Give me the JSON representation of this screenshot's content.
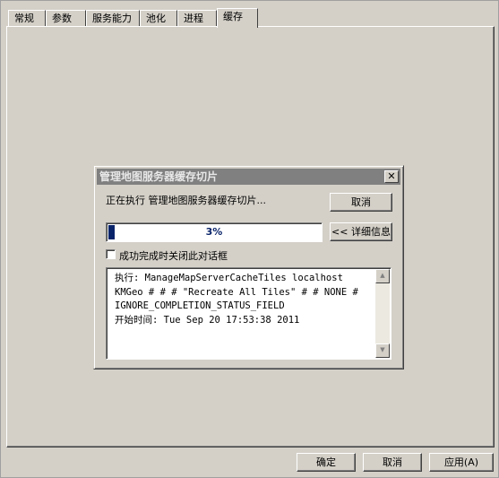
{
  "tabs": [
    {
      "label": "常规"
    },
    {
      "label": "参数"
    },
    {
      "label": "服务能力"
    },
    {
      "label": "池化"
    },
    {
      "label": "进程"
    },
    {
      "label": "缓存",
      "active": true
    }
  ],
  "dialog": {
    "title": "管理地图服务器缓存切片",
    "close_glyph": "✕",
    "status": "正在执行 管理地图服务器缓存切片...",
    "cancel_label": "取消",
    "details_label": "<< 详细信息",
    "progress": {
      "value": 3,
      "label": "3%"
    },
    "checkbox": {
      "label": "成功完成时关闭此对话框",
      "checked": false
    },
    "log": {
      "lines": [
        "执行: ManageMapServerCacheTiles localhost",
        "KMGeo # # # \"Recreate All Tiles\" # # NONE #",
        "IGNORE_COMPLETION_STATUS_FIELD",
        "开始时间: Tue Sep 20 17:53:38 2011"
      ]
    }
  },
  "footer": {
    "ok_label": "确定",
    "cancel_label": "取消",
    "apply_label": "应用(A)"
  },
  "colors": {
    "face": "#d4d0c8",
    "titlebar_inactive": "#808080",
    "progress": "#0a246a"
  },
  "icons": {
    "close": "close-icon",
    "scroll_up": "scroll-up-icon",
    "scroll_down": "scroll-down-icon"
  }
}
